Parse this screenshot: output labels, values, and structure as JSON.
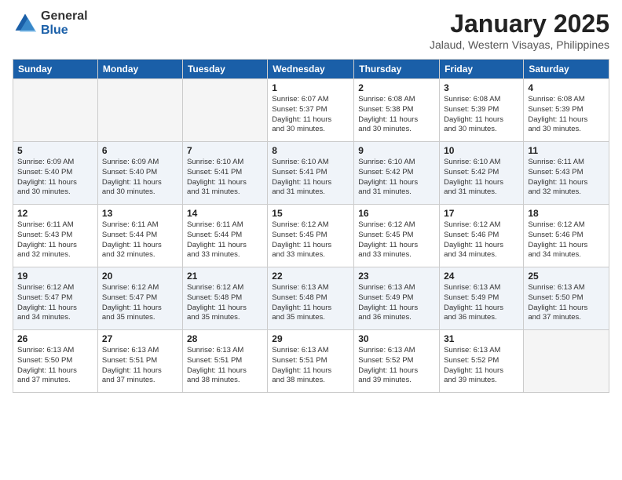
{
  "logo": {
    "general": "General",
    "blue": "Blue"
  },
  "header": {
    "month": "January 2025",
    "location": "Jalaud, Western Visayas, Philippines"
  },
  "weekdays": [
    "Sunday",
    "Monday",
    "Tuesday",
    "Wednesday",
    "Thursday",
    "Friday",
    "Saturday"
  ],
  "weeks": [
    [
      {
        "day": "",
        "info": ""
      },
      {
        "day": "",
        "info": ""
      },
      {
        "day": "",
        "info": ""
      },
      {
        "day": "1",
        "info": "Sunrise: 6:07 AM\nSunset: 5:37 PM\nDaylight: 11 hours\nand 30 minutes."
      },
      {
        "day": "2",
        "info": "Sunrise: 6:08 AM\nSunset: 5:38 PM\nDaylight: 11 hours\nand 30 minutes."
      },
      {
        "day": "3",
        "info": "Sunrise: 6:08 AM\nSunset: 5:39 PM\nDaylight: 11 hours\nand 30 minutes."
      },
      {
        "day": "4",
        "info": "Sunrise: 6:08 AM\nSunset: 5:39 PM\nDaylight: 11 hours\nand 30 minutes."
      }
    ],
    [
      {
        "day": "5",
        "info": "Sunrise: 6:09 AM\nSunset: 5:40 PM\nDaylight: 11 hours\nand 30 minutes."
      },
      {
        "day": "6",
        "info": "Sunrise: 6:09 AM\nSunset: 5:40 PM\nDaylight: 11 hours\nand 30 minutes."
      },
      {
        "day": "7",
        "info": "Sunrise: 6:10 AM\nSunset: 5:41 PM\nDaylight: 11 hours\nand 31 minutes."
      },
      {
        "day": "8",
        "info": "Sunrise: 6:10 AM\nSunset: 5:41 PM\nDaylight: 11 hours\nand 31 minutes."
      },
      {
        "day": "9",
        "info": "Sunrise: 6:10 AM\nSunset: 5:42 PM\nDaylight: 11 hours\nand 31 minutes."
      },
      {
        "day": "10",
        "info": "Sunrise: 6:10 AM\nSunset: 5:42 PM\nDaylight: 11 hours\nand 31 minutes."
      },
      {
        "day": "11",
        "info": "Sunrise: 6:11 AM\nSunset: 5:43 PM\nDaylight: 11 hours\nand 32 minutes."
      }
    ],
    [
      {
        "day": "12",
        "info": "Sunrise: 6:11 AM\nSunset: 5:43 PM\nDaylight: 11 hours\nand 32 minutes."
      },
      {
        "day": "13",
        "info": "Sunrise: 6:11 AM\nSunset: 5:44 PM\nDaylight: 11 hours\nand 32 minutes."
      },
      {
        "day": "14",
        "info": "Sunrise: 6:11 AM\nSunset: 5:44 PM\nDaylight: 11 hours\nand 33 minutes."
      },
      {
        "day": "15",
        "info": "Sunrise: 6:12 AM\nSunset: 5:45 PM\nDaylight: 11 hours\nand 33 minutes."
      },
      {
        "day": "16",
        "info": "Sunrise: 6:12 AM\nSunset: 5:45 PM\nDaylight: 11 hours\nand 33 minutes."
      },
      {
        "day": "17",
        "info": "Sunrise: 6:12 AM\nSunset: 5:46 PM\nDaylight: 11 hours\nand 34 minutes."
      },
      {
        "day": "18",
        "info": "Sunrise: 6:12 AM\nSunset: 5:46 PM\nDaylight: 11 hours\nand 34 minutes."
      }
    ],
    [
      {
        "day": "19",
        "info": "Sunrise: 6:12 AM\nSunset: 5:47 PM\nDaylight: 11 hours\nand 34 minutes."
      },
      {
        "day": "20",
        "info": "Sunrise: 6:12 AM\nSunset: 5:47 PM\nDaylight: 11 hours\nand 35 minutes."
      },
      {
        "day": "21",
        "info": "Sunrise: 6:12 AM\nSunset: 5:48 PM\nDaylight: 11 hours\nand 35 minutes."
      },
      {
        "day": "22",
        "info": "Sunrise: 6:13 AM\nSunset: 5:48 PM\nDaylight: 11 hours\nand 35 minutes."
      },
      {
        "day": "23",
        "info": "Sunrise: 6:13 AM\nSunset: 5:49 PM\nDaylight: 11 hours\nand 36 minutes."
      },
      {
        "day": "24",
        "info": "Sunrise: 6:13 AM\nSunset: 5:49 PM\nDaylight: 11 hours\nand 36 minutes."
      },
      {
        "day": "25",
        "info": "Sunrise: 6:13 AM\nSunset: 5:50 PM\nDaylight: 11 hours\nand 37 minutes."
      }
    ],
    [
      {
        "day": "26",
        "info": "Sunrise: 6:13 AM\nSunset: 5:50 PM\nDaylight: 11 hours\nand 37 minutes."
      },
      {
        "day": "27",
        "info": "Sunrise: 6:13 AM\nSunset: 5:51 PM\nDaylight: 11 hours\nand 37 minutes."
      },
      {
        "day": "28",
        "info": "Sunrise: 6:13 AM\nSunset: 5:51 PM\nDaylight: 11 hours\nand 38 minutes."
      },
      {
        "day": "29",
        "info": "Sunrise: 6:13 AM\nSunset: 5:51 PM\nDaylight: 11 hours\nand 38 minutes."
      },
      {
        "day": "30",
        "info": "Sunrise: 6:13 AM\nSunset: 5:52 PM\nDaylight: 11 hours\nand 39 minutes."
      },
      {
        "day": "31",
        "info": "Sunrise: 6:13 AM\nSunset: 5:52 PM\nDaylight: 11 hours\nand 39 minutes."
      },
      {
        "day": "",
        "info": ""
      }
    ]
  ]
}
